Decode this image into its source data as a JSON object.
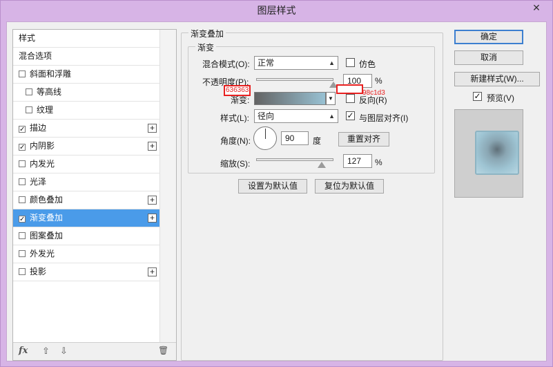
{
  "window": {
    "title": "图层样式",
    "close_glyph": "✕"
  },
  "sidebar": {
    "items": [
      {
        "label": "样式",
        "checkbox": false,
        "checked": false,
        "plus": false,
        "indent": false,
        "selected": false
      },
      {
        "label": "混合选项",
        "checkbox": false,
        "checked": false,
        "plus": false,
        "indent": false,
        "selected": false
      },
      {
        "label": "斜面和浮雕",
        "checkbox": true,
        "checked": false,
        "plus": false,
        "indent": false,
        "selected": false
      },
      {
        "label": "等高线",
        "checkbox": true,
        "checked": false,
        "plus": false,
        "indent": true,
        "selected": false
      },
      {
        "label": "纹理",
        "checkbox": true,
        "checked": false,
        "plus": false,
        "indent": true,
        "selected": false
      },
      {
        "label": "描边",
        "checkbox": true,
        "checked": true,
        "plus": true,
        "indent": false,
        "selected": false
      },
      {
        "label": "内阴影",
        "checkbox": true,
        "checked": true,
        "plus": true,
        "indent": false,
        "selected": false
      },
      {
        "label": "内发光",
        "checkbox": true,
        "checked": false,
        "plus": false,
        "indent": false,
        "selected": false
      },
      {
        "label": "光泽",
        "checkbox": true,
        "checked": false,
        "plus": false,
        "indent": false,
        "selected": false
      },
      {
        "label": "颜色叠加",
        "checkbox": true,
        "checked": false,
        "plus": true,
        "indent": false,
        "selected": false
      },
      {
        "label": "渐变叠加",
        "checkbox": true,
        "checked": true,
        "plus": true,
        "indent": false,
        "selected": true
      },
      {
        "label": "图案叠加",
        "checkbox": true,
        "checked": false,
        "plus": false,
        "indent": false,
        "selected": false
      },
      {
        "label": "外发光",
        "checkbox": true,
        "checked": false,
        "plus": false,
        "indent": false,
        "selected": false
      },
      {
        "label": "投影",
        "checkbox": true,
        "checked": false,
        "plus": true,
        "indent": false,
        "selected": false
      }
    ],
    "bottom": {
      "fx": "fx",
      "up": "⇧",
      "down": "⇩",
      "trash": "🗑"
    }
  },
  "gradient_overlay": {
    "group_title": "渐变叠加",
    "subgroup_title": "渐变",
    "blend_mode_label": "混合模式(O):",
    "blend_mode_value": "正常",
    "dither_label": "仿色",
    "opacity_label": "不透明度(P):",
    "opacity_value": "100",
    "opacity_unit": "%",
    "opacity_level": 100,
    "gradient_label": "渐变:",
    "reverse_label": "反向(R)",
    "style_label": "样式(L):",
    "style_value": "径向",
    "align_label": "与图层对齐(I)",
    "align_checked": true,
    "angle_label": "角度(N):",
    "angle_value": "90",
    "angle_unit": "度",
    "reset_align_button": "重置对齐",
    "scale_label": "缩放(S):",
    "scale_value": "127",
    "scale_unit": "%",
    "scale_level": 127,
    "set_default_button": "设置为默认值",
    "reset_default_button": "复位为默认值",
    "annotation_left": "636363",
    "annotation_right": "98c1d3",
    "colors": {
      "start": "#636363",
      "end": "#98c1d3",
      "annotation": "#e81f1f"
    }
  },
  "right_buttons": {
    "ok": "确定",
    "cancel": "取消",
    "new_style": "新建样式(W)...",
    "preview_label": "预览(V)",
    "preview_checked": true
  }
}
